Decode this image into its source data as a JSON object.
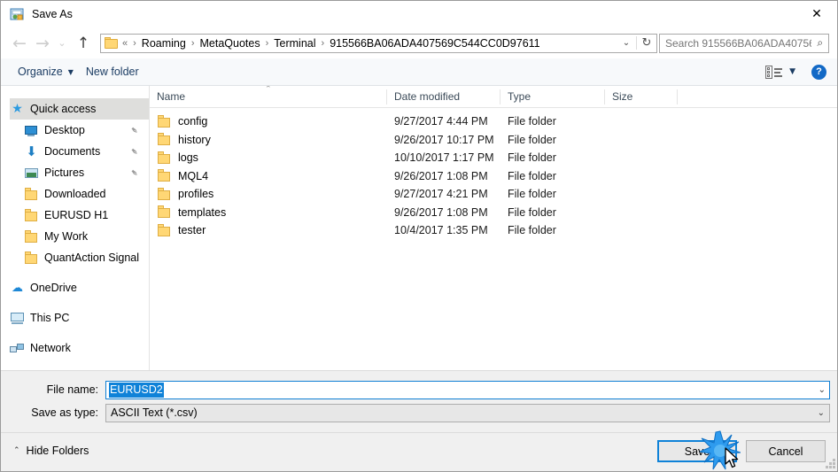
{
  "window": {
    "title": "Save As",
    "title_icon": "save-as-app-icon",
    "close_label": "✕"
  },
  "addressbar": {
    "back_icon": "←",
    "forward_icon": "→",
    "recent_icon": "⌄",
    "up_icon": "↑",
    "folder_icon": "folder-icon",
    "separator": "›",
    "prefix": "«",
    "crumbs": [
      "Roaming",
      "MetaQuotes",
      "Terminal",
      "915566BA06ADA407569C544CC0D97611"
    ],
    "dropdown_icon": "⌄",
    "refresh_icon": "↻",
    "search_placeholder": "Search 915566BA06ADA40756...",
    "search_icon": "⌕"
  },
  "commandbar": {
    "organize_label": "Organize",
    "organize_caret": "▼",
    "new_folder_label": "New folder",
    "view_caret": "▼",
    "help_label": "?"
  },
  "navpane": {
    "items": [
      {
        "label": "Quick access",
        "icon": "star-icon",
        "selected": true,
        "indent": false,
        "pinned": false,
        "gap_before": false
      },
      {
        "label": "Desktop",
        "icon": "desktop-icon",
        "selected": false,
        "indent": true,
        "pinned": true,
        "gap_before": false
      },
      {
        "label": "Documents",
        "icon": "documents-icon",
        "selected": false,
        "indent": true,
        "pinned": true,
        "gap_before": false
      },
      {
        "label": "Pictures",
        "icon": "pictures-icon",
        "selected": false,
        "indent": true,
        "pinned": true,
        "gap_before": false
      },
      {
        "label": "Downloaded",
        "icon": "folder-icon",
        "selected": false,
        "indent": true,
        "pinned": false,
        "gap_before": false
      },
      {
        "label": "EURUSD H1",
        "icon": "folder-icon",
        "selected": false,
        "indent": true,
        "pinned": false,
        "gap_before": false
      },
      {
        "label": "My Work",
        "icon": "folder-icon",
        "selected": false,
        "indent": true,
        "pinned": false,
        "gap_before": false
      },
      {
        "label": "QuantAction Signal",
        "icon": "folder-icon",
        "selected": false,
        "indent": true,
        "pinned": false,
        "gap_before": false
      },
      {
        "label": "OneDrive",
        "icon": "cloud-icon",
        "selected": false,
        "indent": false,
        "pinned": false,
        "gap_before": true
      },
      {
        "label": "This PC",
        "icon": "this-pc-icon",
        "selected": false,
        "indent": false,
        "pinned": false,
        "gap_before": true
      },
      {
        "label": "Network",
        "icon": "network-icon",
        "selected": false,
        "indent": false,
        "pinned": false,
        "gap_before": true
      }
    ],
    "pin_glyph": "✒"
  },
  "filelist": {
    "columns": [
      "Name",
      "Date modified",
      "Type",
      "Size"
    ],
    "sort_indicator": "⌃",
    "rows": [
      {
        "name": "config",
        "icon": "folder-icon",
        "date": "9/27/2017 4:44 PM",
        "type": "File folder",
        "size": ""
      },
      {
        "name": "history",
        "icon": "folder-icon",
        "date": "9/26/2017 10:17 PM",
        "type": "File folder",
        "size": ""
      },
      {
        "name": "logs",
        "icon": "folder-icon",
        "date": "10/10/2017 1:17 PM",
        "type": "File folder",
        "size": ""
      },
      {
        "name": "MQL4",
        "icon": "folder-icon",
        "date": "9/26/2017 1:08 PM",
        "type": "File folder",
        "size": ""
      },
      {
        "name": "profiles",
        "icon": "folder-icon",
        "date": "9/27/2017 4:21 PM",
        "type": "File folder",
        "size": ""
      },
      {
        "name": "templates",
        "icon": "folder-icon",
        "date": "9/26/2017 1:08 PM",
        "type": "File folder",
        "size": ""
      },
      {
        "name": "tester",
        "icon": "folder-icon",
        "date": "10/4/2017 1:35 PM",
        "type": "File folder",
        "size": ""
      }
    ]
  },
  "form": {
    "filename_label": "File name:",
    "filename_value": "EURUSD2",
    "filename_caret": "⌄",
    "savetype_label": "Save as type:",
    "savetype_value": "ASCII Text (*.csv)",
    "savetype_caret": "⌄"
  },
  "footer": {
    "hide_folders_label": "Hide Folders",
    "hide_folders_caret": "⌃",
    "save_label": "Save",
    "cancel_label": "Cancel"
  },
  "colors": {
    "accent": "#0f82d8",
    "folder_yellow": "#ffd775",
    "selection_blue": "#0f82d8",
    "window_bg": "#f0f0f0",
    "nav_selected": "#dededc"
  }
}
